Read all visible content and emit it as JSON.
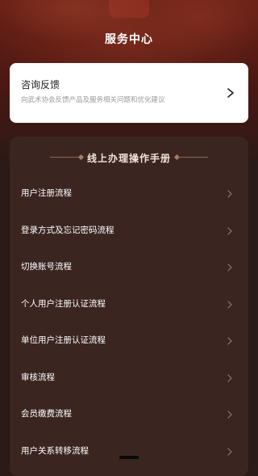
{
  "header": {
    "title": "服务中心"
  },
  "feedback": {
    "title": "咨询反馈",
    "description": "向武术协会反馈产品及服务相关问题和优化建议",
    "chevron_icon": "chevron-right-icon"
  },
  "manual": {
    "title": "线上办理操作手册",
    "items": [
      {
        "label": "用户注册流程"
      },
      {
        "label": "登录方式及忘记密码流程"
      },
      {
        "label": "切换账号流程"
      },
      {
        "label": "个人用户注册认证流程"
      },
      {
        "label": "单位用户注册认证流程"
      },
      {
        "label": "审核流程"
      },
      {
        "label": "会员缴费流程"
      },
      {
        "label": "用户关系转移流程"
      }
    ]
  },
  "colors": {
    "background": "#2b1a17",
    "header_red": "#6a2117",
    "panel": "#3a2521",
    "card": "#ffffff"
  }
}
